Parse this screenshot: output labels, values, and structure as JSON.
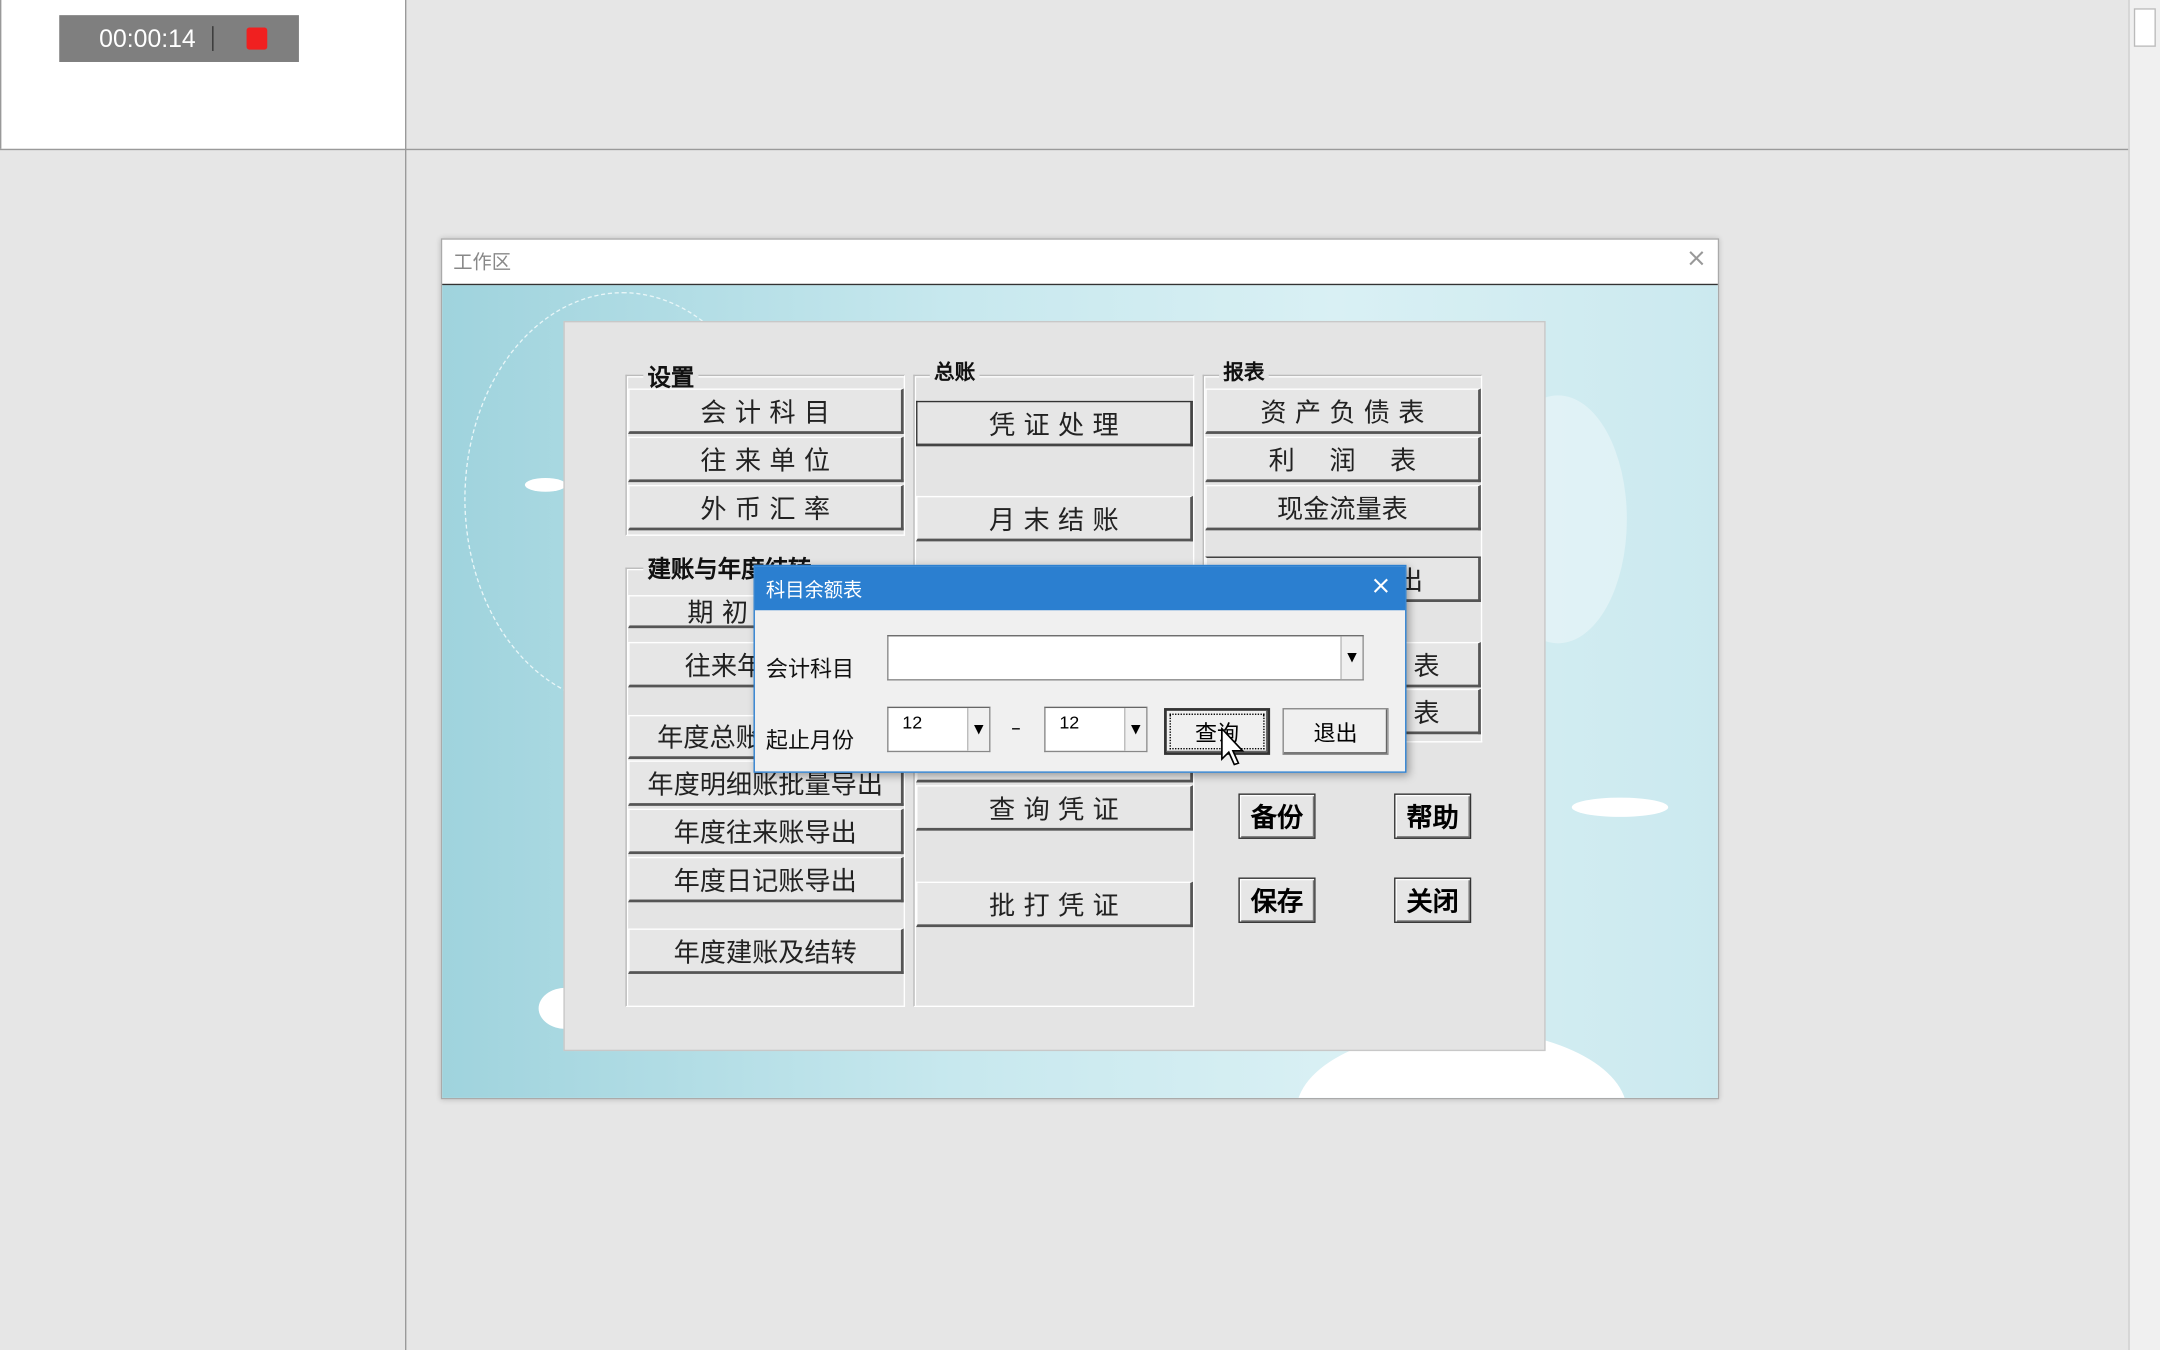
{
  "recorder": {
    "elapsed": "00:00:14",
    "stop_icon": "stop-icon",
    "stop_color": "#f02020"
  },
  "workspace": {
    "title": "工作区",
    "close": "×"
  },
  "groups": {
    "setup": {
      "label": "设置",
      "buttons": [
        "会 计 科 目",
        "往 来 单 位",
        "外 币 汇 率"
      ]
    },
    "yearend": {
      "label": "建账与年度结转",
      "buttons": [
        "期 初",
        "往来年",
        "年度总账",
        "年度明细账批量导出",
        "年度往来账导出",
        "年度日记账导出",
        "年度建账及结转"
      ]
    },
    "ledger": {
      "label": "总账",
      "buttons": [
        "凭 证 处 理",
        "月 末 结 账",
        "查 询 凭 证",
        "批 打 凭 证"
      ]
    },
    "reports": {
      "label": "报表",
      "buttons": [
        "资 产 负 债 表",
        "利　 润　 表",
        "现金流量表",
        "出",
        "表",
        "表"
      ]
    }
  },
  "actions": {
    "backup": "备份",
    "help": "帮助",
    "save": "保存",
    "close": "关闭"
  },
  "dialog": {
    "title": "科目余额表",
    "close": "×",
    "account_label": "会计科目",
    "account_value": "",
    "period_label": "起止月份",
    "start_month": "12",
    "dash": "–",
    "end_month": "12",
    "query": "查询",
    "exit": "退出",
    "accent": "#2b7fd0"
  }
}
